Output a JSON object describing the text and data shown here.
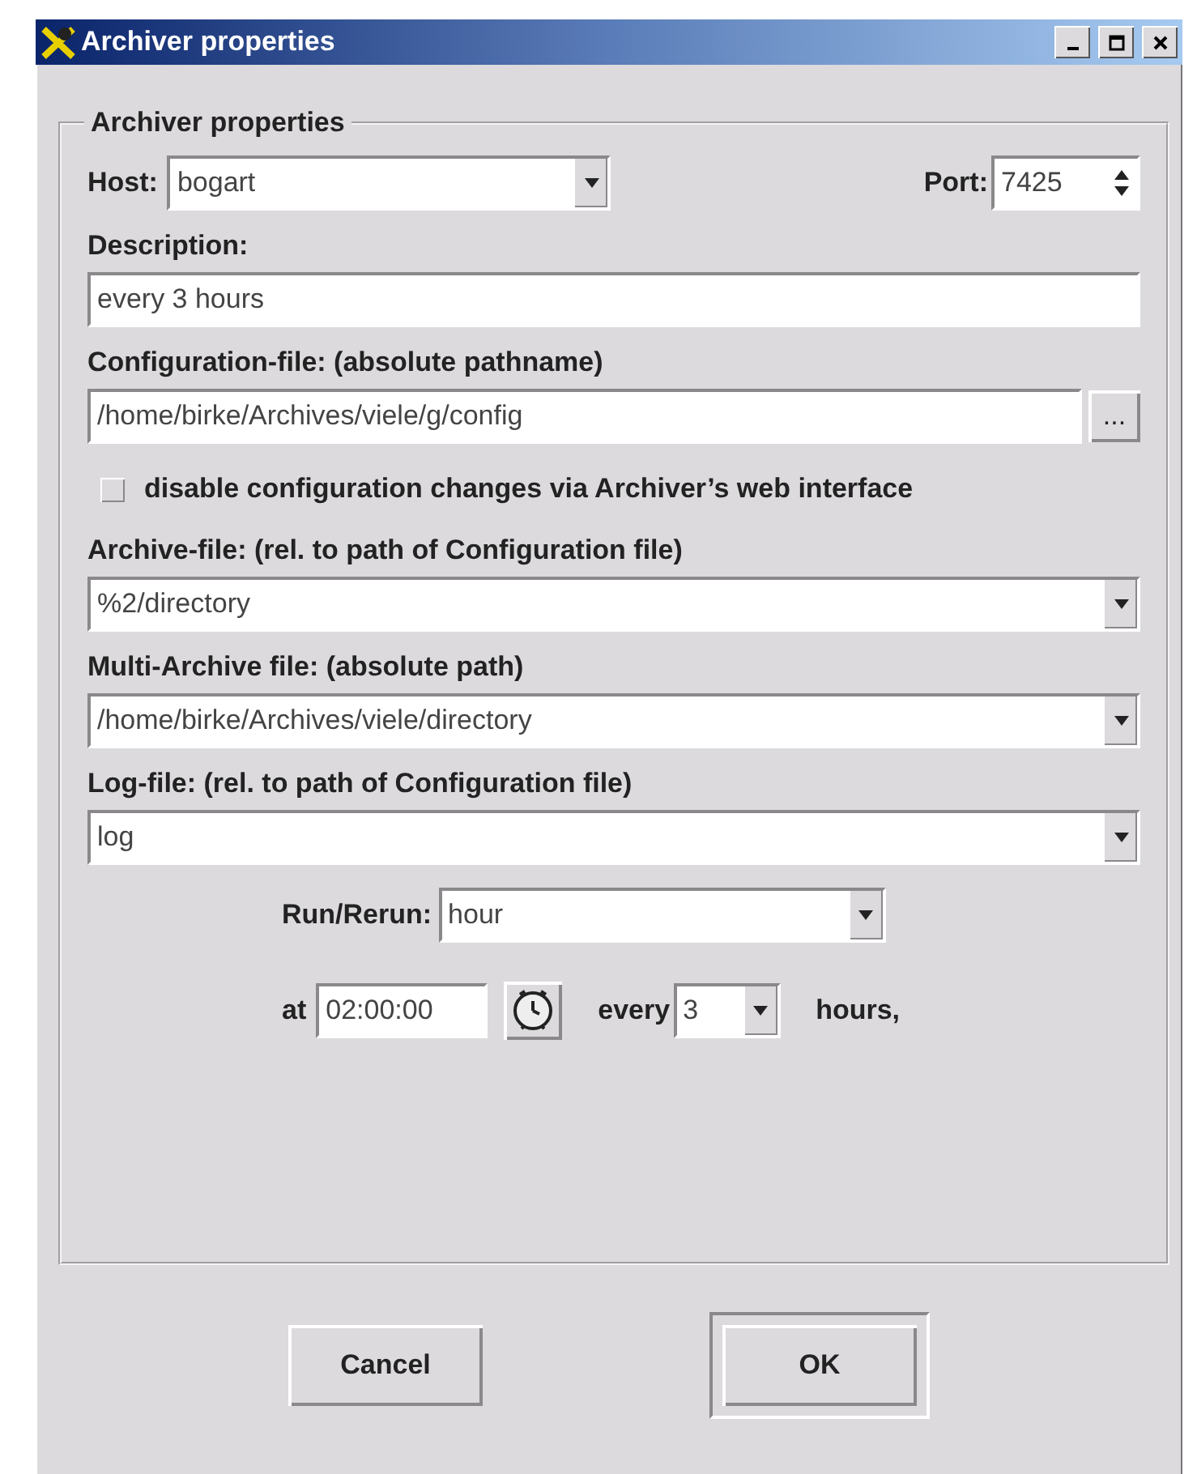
{
  "window": {
    "title": "Archiver properties"
  },
  "group": {
    "title": "Archiver properties"
  },
  "host": {
    "label": "Host:",
    "value": "bogart"
  },
  "port": {
    "label": "Port:",
    "value": "7425"
  },
  "description": {
    "label": "Description:",
    "value": "every 3 hours"
  },
  "config_file": {
    "label": "Configuration-file: (absolute pathname)",
    "value": "/home/birke/Archives/viele/g/config",
    "browse": "..."
  },
  "disable_web_config": {
    "label": "disable configuration changes via Archiver’s web interface",
    "checked": false
  },
  "archive_file": {
    "label": "Archive-file: (rel. to path of Configuration file)",
    "value": "%2/directory"
  },
  "multi_archive_file": {
    "label": "Multi-Archive file: (absolute path)",
    "value": "/home/birke/Archives/viele/directory"
  },
  "log_file": {
    "label": "Log-file: (rel. to path of Configuration file)",
    "value": "log"
  },
  "run": {
    "label": "Run/Rerun:",
    "value": "hour"
  },
  "schedule": {
    "at_label": "at",
    "time": "02:00:00",
    "every_label": "every",
    "interval": "3",
    "unit_label": "hours,"
  },
  "buttons": [
    {
      "label": "Cancel",
      "default": false
    },
    {
      "label": "OK",
      "default": true
    }
  ]
}
